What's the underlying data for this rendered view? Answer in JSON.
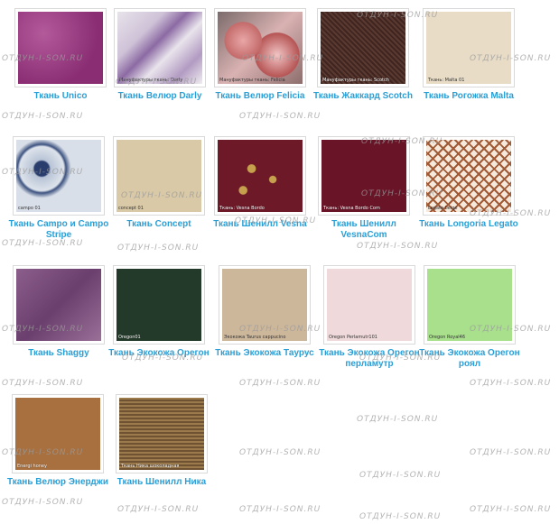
{
  "watermark": "ОТДУН-І-SON.RU",
  "link_color": "#2a9fd6",
  "items": [
    {
      "name": "Ткань Unico",
      "label": ""
    },
    {
      "name": "Ткань Велюр Darly",
      "label": "Мануфактуры ткань: Darly"
    },
    {
      "name": "Ткань Велюр Felicia",
      "label": "Мануфактуры ткань: Felicia"
    },
    {
      "name": "Ткань Жаккард Scotch",
      "label": "Мануфактуры ткань: Scotch"
    },
    {
      "name": "Ткань Рогожка Malta",
      "label": "Ткань: Malta 01"
    },
    {
      "name": "Ткань Campo и Campo Stripe",
      "label": "campo 01"
    },
    {
      "name": "Ткань Concept",
      "label": "concept 01"
    },
    {
      "name": "Ткань Шенилл Vesna",
      "label": "Ткань: Vesna Bordo"
    },
    {
      "name": "Ткань Шенилл VesnaCom",
      "label": "Ткань: Vesna Bordo Com"
    },
    {
      "name": "Ткань Longoria Legato",
      "label": "Legato beige"
    },
    {
      "name": "Ткань Shaggy",
      "label": ""
    },
    {
      "name": "Ткань Экокожа Орегон",
      "label": "Oregon01"
    },
    {
      "name": "Ткань Экокожа Таурус",
      "label": "Экокожа Taurus cappucino"
    },
    {
      "name": "Ткань Экокожа Орегон перламутр",
      "label": "Oregon Perlamutr101"
    },
    {
      "name": "Ткань Экокожа Орегон роял",
      "label": "Oregon Royal46"
    },
    {
      "name": "Ткань Велюр Энерджи",
      "label": "Energi honey"
    },
    {
      "name": "Ткань Шенилл Ника",
      "label": "Ткань Ника шоколадная"
    }
  ]
}
